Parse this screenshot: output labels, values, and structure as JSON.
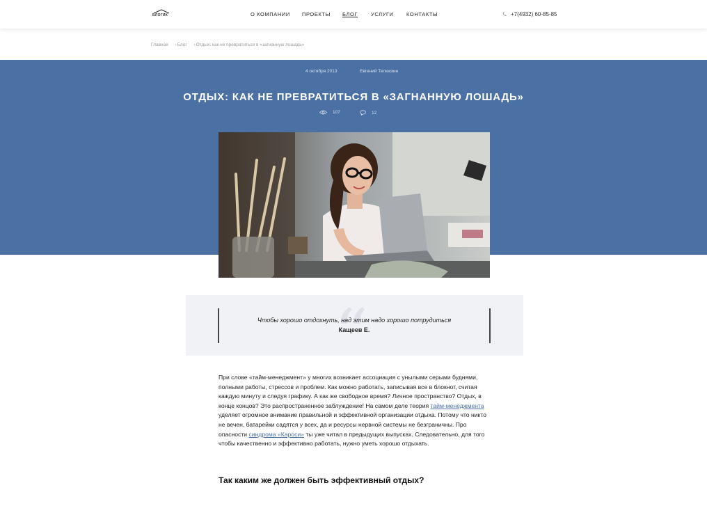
{
  "header": {
    "logo_text": "БЛОГИК",
    "nav": [
      {
        "label": "О КОМПАНИИ",
        "active": false
      },
      {
        "label": "ПРОЕКТЫ",
        "active": false
      },
      {
        "label": "БЛОГ",
        "active": true
      },
      {
        "label": "УСЛУГИ",
        "active": false
      },
      {
        "label": "КОНТАКТЫ",
        "active": false
      }
    ],
    "phone": "+7(4932) 60-85-85",
    "phone_icon": "phone-icon"
  },
  "breadcrumb": [
    "Главная",
    "Блог",
    "Отдых: как не превратиться в «загнанную лошадь»"
  ],
  "post": {
    "date": "4 октября 2013",
    "author": "Евгений Телюскин",
    "title": "ОТДЫХ: КАК НЕ ПРЕВРАТИТЬСЯ В «ЗАГНАННУЮ ЛОШАДЬ»",
    "views": "107",
    "comments": "12",
    "views_icon": "eye-icon",
    "comments_icon": "comment-icon"
  },
  "quote": {
    "text": "Чтобы хорошо отдохнуть, над этим надо хорошо потрудиться",
    "author": "Кащеев Е."
  },
  "article": {
    "p1_a": "При слове «тайм-менеджмент» у многих возникает ассоциация с унылыми серыми буднями, полными работы, стрессов и проблем. Как можно работать, записывая все в блокнот, считая каждую минуту и следуя графику. А как же свободное время? Личное пространство? Отдых, в конце концов? Это распространенное заблуждение! На самом деле теория ",
    "link1": "тайм-менеджмента",
    "p1_b": " уделяет огромное внимание правильной и эффективной организации отдыха. Потому что никто не вечен, батарейки садятся у всех, да и ресурсы нервной системы не безграничны. Про опасности ",
    "link2": "синдрома «Кароси»",
    "p1_c": " ты уже читал в предыдущих выпусках. Следовательно, для того чтобы качественно и эффективно работать, нужно уметь хорошо отдыхать.",
    "h2": "Так каким же должен быть эффективный отдых?"
  },
  "colors": {
    "hero": "#4a70a4",
    "link": "#4a70a4",
    "quote_bg": "#f1f2f5"
  }
}
